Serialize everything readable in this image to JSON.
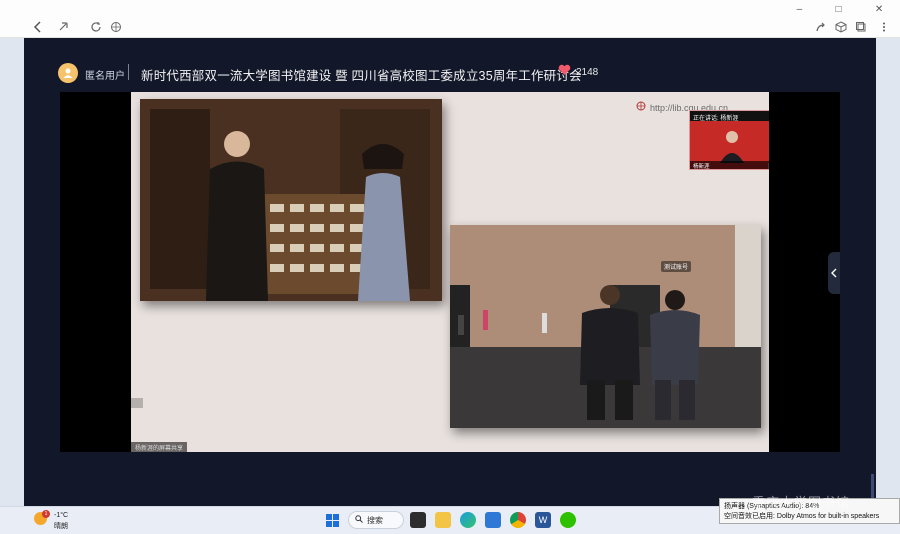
{
  "browser": {
    "icons": [
      "back-icon",
      "link-icon",
      "refresh-icon",
      "globe-icon",
      "share-icon",
      "cube-icon",
      "copy-icon",
      "more-icon"
    ],
    "window_controls": [
      "–",
      "□",
      "✕"
    ]
  },
  "header": {
    "user_label": "匿名用户",
    "title": "新时代西部双一流大学图书馆建设 暨 四川省高校图工委成立35周年工作研讨会",
    "like_count": "2148"
  },
  "slide": {
    "url_text": "http://lib.cqu.edu.cn",
    "speaker_tile_top": "正在讲话: 杨新涯",
    "speaker_tile_bottom": "杨新涯",
    "scene_tag": "测试账号",
    "bottom_tag": "杨新涯的屏幕共享"
  },
  "taskbar": {
    "weather_temp": "-1°C",
    "weather_desc": "晴朗",
    "weather_badge": "1",
    "search_label": "搜索",
    "icons": [
      "windows-icon",
      "search-icon",
      "taskview-icon",
      "explorer-icon",
      "edge-icon",
      "store-icon",
      "chrome-icon",
      "word-icon",
      "wechat-icon"
    ]
  },
  "tooltip": {
    "line1": "扬声器 (Synaptics Audio): 84%",
    "line2": "空间音效已启用:  Dolby Atmos for built-in speakers"
  },
  "watermark": "重庆大学图书馆",
  "colors": {
    "page_bg": "#12172a",
    "like": "#f05a6a",
    "accent": "#3d4a74"
  }
}
